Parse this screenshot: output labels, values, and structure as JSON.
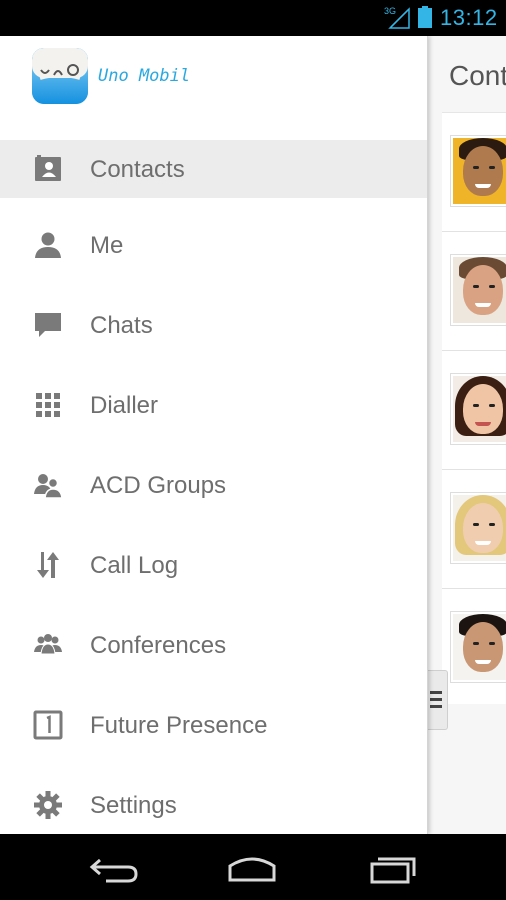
{
  "status_bar": {
    "network": "3G",
    "time": "13:12",
    "accent_color": "#33b5e5"
  },
  "app": {
    "name": "Uno Mobil",
    "brand_color": "#2aa8e0"
  },
  "content": {
    "title": "Cont"
  },
  "nav": {
    "items": [
      {
        "label": "Contacts",
        "icon": "contacts-icon",
        "active": true
      },
      {
        "label": "Me",
        "icon": "person-icon",
        "active": false
      },
      {
        "label": "Chats",
        "icon": "chat-bubble-icon",
        "active": false
      },
      {
        "label": "Dialler",
        "icon": "dialpad-icon",
        "active": false
      },
      {
        "label": "ACD Groups",
        "icon": "group-icon",
        "active": false
      },
      {
        "label": "Call Log",
        "icon": "call-log-arrows-icon",
        "active": false
      },
      {
        "label": "Conferences",
        "icon": "conference-icon",
        "active": false
      },
      {
        "label": "Future Presence",
        "icon": "calendar-icon",
        "active": false
      },
      {
        "label": "Settings",
        "icon": "gear-icon",
        "active": false
      }
    ]
  },
  "contacts": [
    {
      "avatar": "contact-avatar-1"
    },
    {
      "avatar": "contact-avatar-2"
    },
    {
      "avatar": "contact-avatar-3"
    },
    {
      "avatar": "contact-avatar-4"
    },
    {
      "avatar": "contact-avatar-5"
    }
  ],
  "system_nav": {
    "buttons": [
      "back-icon",
      "home-icon",
      "recent-apps-icon"
    ]
  }
}
